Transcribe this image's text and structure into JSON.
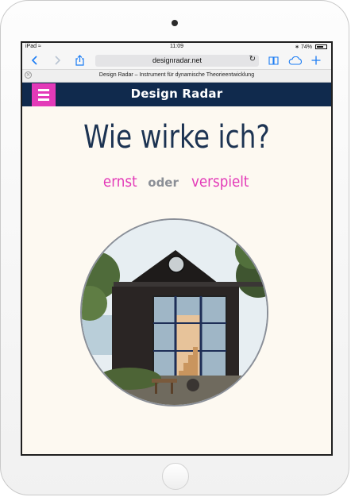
{
  "status_bar": {
    "device": "iPad",
    "time": "11:09",
    "battery_text": "74%",
    "battery_level": 0.74
  },
  "browser": {
    "url": "designradar.net",
    "tab_title": "Design Radar – Instrument für dynamische Theorieentwicklung"
  },
  "icons": {
    "wifi": "wifi-icon",
    "back": "back-arrow-icon",
    "forward": "forward-arrow-icon",
    "share": "share-icon",
    "reload": "reload-icon",
    "bookmarks": "book-icon",
    "cloud": "cloud-icon",
    "new_tab": "plus-icon",
    "menu": "hamburger-icon"
  },
  "site": {
    "title": "Design Radar"
  },
  "hero": {
    "headline": "Wie wirke ich?",
    "option_left": "ernst",
    "conjunction": "oder",
    "option_right": "verspielt"
  },
  "colors": {
    "header_bg": "#102a4d",
    "accent_magenta": "#e33ab8",
    "headline": "#1c3352",
    "page_bg": "#fdf9f1",
    "safari_blue": "#1b7cf4"
  }
}
